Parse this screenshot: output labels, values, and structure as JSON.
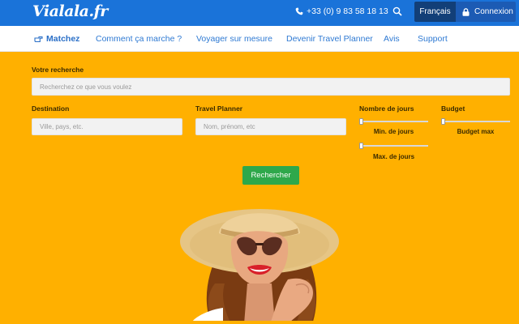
{
  "header": {
    "logo": "Vialala.fr",
    "phone": "+33 (0) 9 83 58 18 13",
    "language": "Français",
    "login": "Connexion"
  },
  "nav": {
    "items": [
      {
        "label": "Matchez"
      },
      {
        "label": "Comment ça marche ?"
      },
      {
        "label": "Voyager sur mesure"
      },
      {
        "label": "Devenir Travel Planner"
      },
      {
        "label": "Avis"
      },
      {
        "label": "Support"
      }
    ]
  },
  "search": {
    "title": "Votre recherche",
    "query_placeholder": "Recherchez ce que vous voulez",
    "destination_label": "Destination",
    "destination_placeholder": "Ville, pays, etc.",
    "planner_label": "Travel Planner",
    "planner_placeholder": "Nom, prénom, etc",
    "days_label": "Nombre de jours",
    "days_min_caption": "Min. de jours",
    "days_max_caption": "Max. de jours",
    "days_min_level": 0,
    "days_max_level": 0,
    "budget_label": "Budget",
    "budget_max_caption": "Budget max",
    "budget_max_level": 0,
    "submit": "Rechercher"
  },
  "colors": {
    "topbar": "#1a73d9",
    "page_background": "#ffb000",
    "submit": "#2ea84b"
  },
  "icons": {
    "phone": "phone-icon",
    "search": "search-icon",
    "lock": "lock-icon",
    "match": "hand-pointing-icon"
  }
}
